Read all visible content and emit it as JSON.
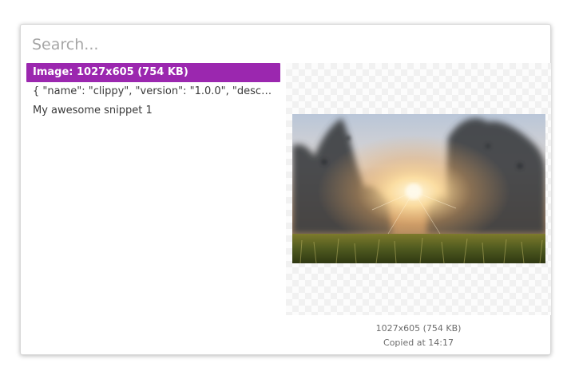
{
  "search": {
    "placeholder": "Search..."
  },
  "clipboard_items": [
    {
      "label": "Image: 1027x605 (754 KB)",
      "selected": true
    },
    {
      "label": "{ \"name\": \"clippy\", \"version\": \"1.0.0\", \"descr...",
      "selected": false
    },
    {
      "label": "My awesome snippet 1",
      "selected": false
    }
  ],
  "preview": {
    "image_semantic": "sunset-meadow-photo",
    "size_info": "1027x605 (754 KB)",
    "copied_at": "Copied at 14:17"
  },
  "colors": {
    "selection": "#9b27af",
    "text": "#3a3a3a",
    "placeholder": "#a6a6a6",
    "meta": "#6d6d6d"
  }
}
